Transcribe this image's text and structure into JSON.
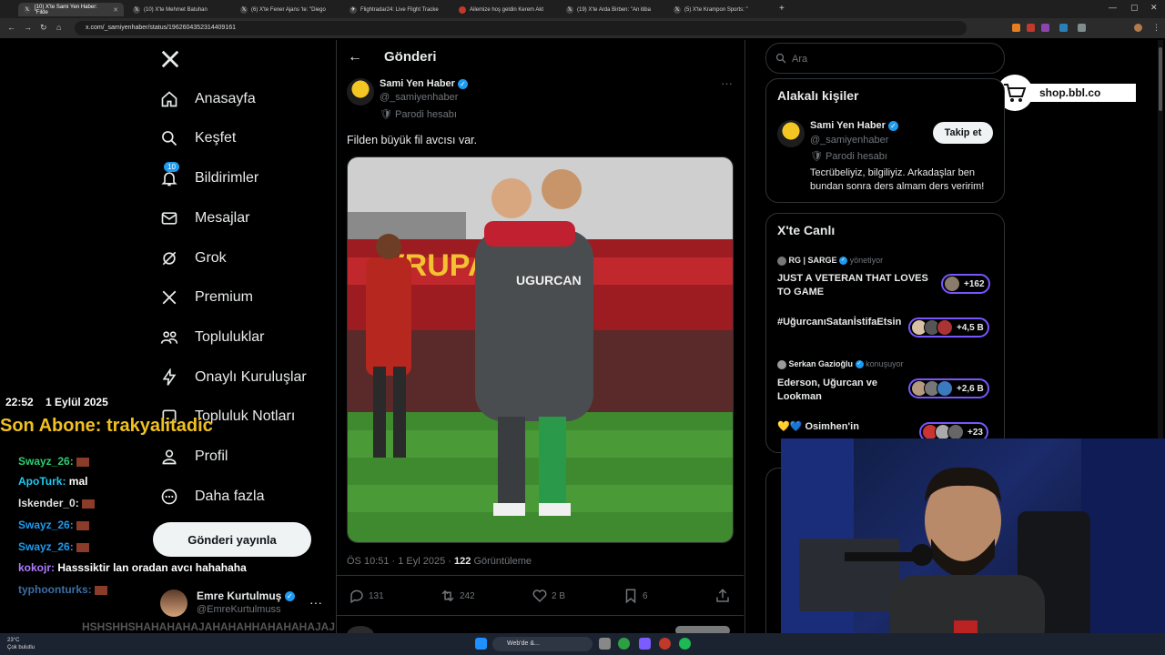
{
  "browser": {
    "tabs": [
      {
        "label": "(10) X'te Sami Yen Haber: \"Filde",
        "active": true
      },
      {
        "label": "(10) X'te Mehmet Batuhan",
        "active": false
      },
      {
        "label": "(6) X'te Fener Ajans 'te: \"Diego",
        "active": false
      },
      {
        "label": "Flightradar24: Live Flight Tracke",
        "active": false
      },
      {
        "label": "Ailemize hoş geldin Kerem Akt",
        "active": false
      },
      {
        "label": "(19) X'te Arda Birben: \"An itiba",
        "active": false
      },
      {
        "label": "(5) X'te Krampon Sports: \"",
        "active": false
      }
    ],
    "url": "x.com/_samiyenhaber/status/1962604352314409161"
  },
  "nav": {
    "items": [
      {
        "label": "Anasayfa",
        "icon": "home-icon"
      },
      {
        "label": "Keşfet",
        "icon": "search-icon"
      },
      {
        "label": "Bildirimler",
        "icon": "bell-icon",
        "badge": "10"
      },
      {
        "label": "Mesajlar",
        "icon": "mail-icon"
      },
      {
        "label": "Grok",
        "icon": "grok-icon"
      },
      {
        "label": "Premium",
        "icon": "x-logo-icon"
      },
      {
        "label": "Topluluklar",
        "icon": "people-icon"
      },
      {
        "label": "Onaylı Kuruluşlar",
        "icon": "lightning-icon"
      },
      {
        "label": "Topluluk Notları",
        "icon": "notes-icon"
      },
      {
        "label": "Profil",
        "icon": "person-icon"
      },
      {
        "label": "Daha fazla",
        "icon": "more-circle-icon"
      }
    ],
    "post_button": "Gönderi yayınla",
    "account": {
      "name": "Emre Kurtulmuş",
      "handle": "@EmreKurtulmuss"
    }
  },
  "post": {
    "header_title": "Gönderi",
    "author_name": "Sami Yen Haber",
    "author_handle": "@_samiyenhaber",
    "parody_label": "Parodi hesabı",
    "text": "Filden büyük fil avcısı var.",
    "image_jersey_text": "UGURCAN",
    "timestamp": "ÖS 10:51 · 1 Eyl 2025 ·",
    "views_count": "122",
    "views_label": "Görüntüleme",
    "replies": "131",
    "reposts": "242",
    "likes": "2 B",
    "bookmarks": "6"
  },
  "search": {
    "placeholder": "Ara"
  },
  "related": {
    "title": "Alakalı kişiler",
    "name": "Sami Yen Haber",
    "handle": "@_samiyenhaber",
    "parody_label": "Parodi hesabı",
    "bio": "Tecrübeliyiz, bilgiliyiz. Arkadaşlar ben bundan sonra ders almam ders veririm!",
    "follow_label": "Takip et"
  },
  "live": {
    "title": "X'te Canlı",
    "items": [
      {
        "host": "RG | SARGE",
        "role": "yönetiyor",
        "title": "JUST A VETERAN THAT LOVES TO GAME",
        "count": "+162"
      },
      {
        "host": "",
        "role": "",
        "title": "#UğurcanıSatanİstifaEtsin",
        "count": "+4,5 B"
      },
      {
        "host": "Serkan Gazioğlu",
        "role": "konuşuyor",
        "title": "Ederson, Uğurcan ve Lookman",
        "count": "+2,6 B"
      },
      {
        "host": "",
        "role": "",
        "title": "💛💙 Osimhen'in",
        "count": "+23"
      }
    ]
  },
  "overlay": {
    "shop_label": "shop.bbl.co",
    "time": "22:52",
    "date": "1 Eylül 2025",
    "last_sub": "Son Abone: trakyalitadic",
    "chat": [
      {
        "user": "Swayz_26:",
        "msg": "",
        "color": "#2ecc71"
      },
      {
        "user": "ApoTurk:",
        "msg": "mal",
        "color": "#1ec9f0"
      },
      {
        "user": "Iskender_0:",
        "msg": "",
        "color": "#e0e0e0"
      },
      {
        "user": "Swayz_26:",
        "msg": "",
        "color": "#1e9bf0"
      },
      {
        "user": "Swayz_26:",
        "msg": "",
        "color": "#1e9bf0"
      },
      {
        "user": "kokojr:",
        "msg": "Hasssiktir lan oradan avcı hahahaha",
        "color": "#b07cff"
      },
      {
        "user": "typhoonturks:",
        "msg": "",
        "color": "#3a6ea5"
      },
      {
        "user": "",
        "msg": "HSHSHHSHAHAHAHAJAHAHAHHAHAHAHAJAJ",
        "color": "#555"
      }
    ]
  },
  "taskbar": {
    "weather_temp": "23°C",
    "weather_desc": "Çok bulutlu",
    "search_label": "Web'de &..."
  }
}
